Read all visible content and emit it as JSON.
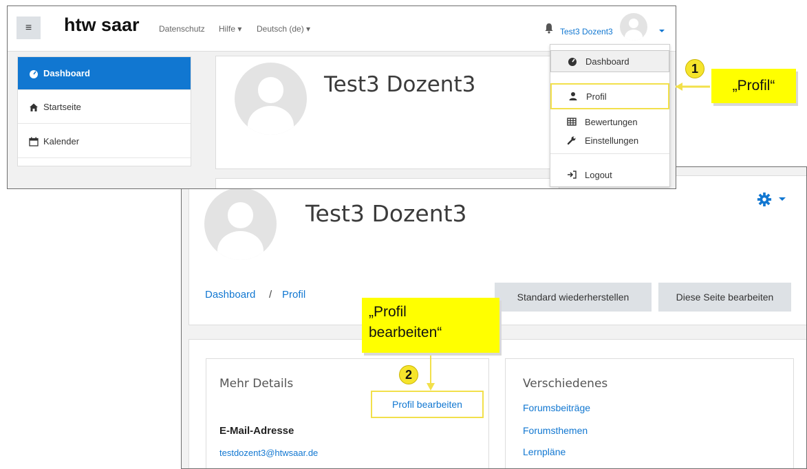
{
  "colors": {
    "accent": "#1177d1",
    "highlight": "#ffff00",
    "callout_border": "#f2e04a"
  },
  "dashboard_window": {
    "brand": "htw saar",
    "nav": {
      "menu_icon": "hamburger-icon",
      "privacy": "Datenschutz",
      "help": "Hilfe ▾",
      "language": "Deutsch (de) ▾"
    },
    "user": {
      "name": "Test3 Dozent3"
    },
    "sidebar": {
      "items": [
        {
          "label": "Dashboard",
          "icon": "dashboard-icon",
          "active": true
        },
        {
          "label": "Startseite",
          "icon": "home-icon"
        },
        {
          "label": "Kalender",
          "icon": "calendar-icon"
        }
      ]
    },
    "main": {
      "name": "Test3 Dozent3"
    },
    "user_menu": {
      "items": [
        {
          "label": "Dashboard",
          "icon": "dashboard-icon"
        },
        {
          "label": "Profil",
          "icon": "user-icon"
        },
        {
          "label": "Bewertungen",
          "icon": "grid-icon"
        },
        {
          "label": "Einstellungen",
          "icon": "wrench-icon"
        },
        {
          "label": "Logout",
          "icon": "logout-icon"
        }
      ]
    }
  },
  "profile_window": {
    "name": "Test3 Dozent3",
    "breadcrumb": {
      "first": "Dashboard",
      "separator": "/",
      "second": "Profil"
    },
    "buttons": {
      "reset": "Standard wiederherstellen",
      "edit_page": "Diese Seite bearbeiten"
    },
    "details": {
      "title": "Mehr Details",
      "edit_link": "Profil bearbeiten",
      "email_label": "E-Mail-Adresse",
      "email_value": "testdozent3@htwsaar.de"
    },
    "misc": {
      "title": "Verschiedenes",
      "links": [
        "Forumsbeiträge",
        "Forumsthemen",
        "Lernpläne"
      ]
    }
  },
  "annotations": {
    "step1": {
      "number": "1",
      "text": "„Profil“"
    },
    "step2": {
      "number": "2",
      "text_line1": "„Profil",
      "text_line2": "bearbeiten“"
    }
  }
}
